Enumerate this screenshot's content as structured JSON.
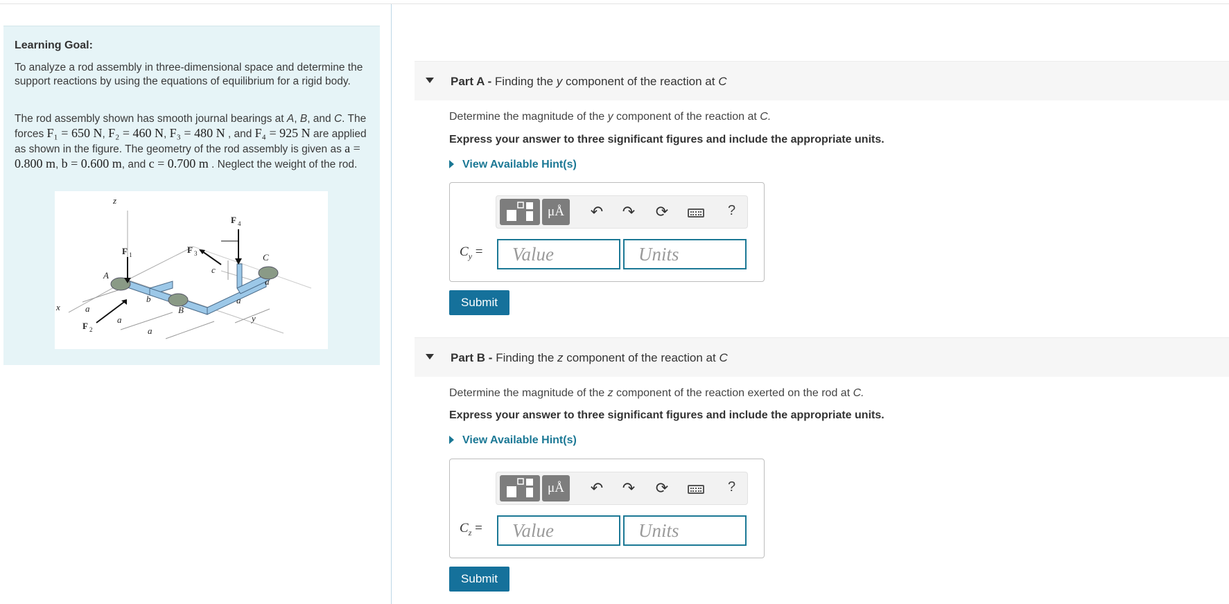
{
  "goal": {
    "label": "Learning Goal:",
    "intro": "To analyze a rod assembly in three-dimensional space and determine the support reactions by using the equations of equilibrium for a rigid body.",
    "p2_a": "The rod assembly shown has smooth journal bearings at ",
    "p2_A": "A",
    "p2_comma1": ", ",
    "p2_B": "B",
    "p2_and": ", and ",
    "p2_C": "C",
    "p2_forces": ". The forces ",
    "F1": "F₁ = 650 N",
    "F2": "F₂ = 460 N",
    "F3": "F₃ = 480 N",
    "F3_tail": " , and",
    "F4": "F₄ = 925 N",
    "applied": " are applied as shown in the figure. The geometry of the rod assembly is given as ",
    "a_val": "a = 0.800 m",
    "b_val": "b = 0.600 m",
    "and": ", and",
    "c_val": "c = 0.700 m",
    "neglect": " . Neglect the weight of the rod."
  },
  "figure": {
    "labels": {
      "z": "z",
      "x": "x",
      "y": "y",
      "F1": "F",
      "F1s": "1",
      "F2": "F",
      "F2s": "2",
      "F3": "F",
      "F3s": "3",
      "F4": "F",
      "F4s": "4",
      "A": "A",
      "B": "B",
      "C": "C",
      "a": "a",
      "b": "b",
      "c": "c"
    }
  },
  "partA": {
    "part": "Part A -",
    "title_pre": " Finding the ",
    "title_var": "y",
    "title_post": " component of the reaction at ",
    "title_pt": "C",
    "question_pre": "Determine the magnitude of the ",
    "question_var": "y",
    "question_post": " component of the reaction at ",
    "question_pt": "C.",
    "instruction": "Express your answer to three significant figures and include the appropriate units.",
    "hint": "View Available Hint(s)",
    "var": "C",
    "var_sub": "y",
    "equals": " =",
    "value_placeholder": "Value",
    "units_placeholder": "Units",
    "submit": "Submit"
  },
  "partB": {
    "part": "Part B -",
    "title_pre": " Finding the ",
    "title_var": "z",
    "title_post": " component of the reaction at ",
    "title_pt": "C",
    "question_pre": "Determine the magnitude of the ",
    "question_var": "z",
    "question_post": " component of the reaction exerted on the rod at ",
    "question_pt": "C.",
    "instruction": "Express your answer to three significant figures and include the appropriate units.",
    "hint": "View Available Hint(s)",
    "var": "C",
    "var_sub": "z",
    "equals": " =",
    "value_placeholder": "Value",
    "units_placeholder": "Units",
    "submit": "Submit"
  },
  "toolbar": {
    "mu": "μÅ",
    "undo_icon": "undo-icon",
    "redo_icon": "redo-icon",
    "reset_icon": "reset-icon",
    "keyboard_icon": "keyboard-icon",
    "help": "?"
  },
  "colors": {
    "accent": "#1b7895",
    "submit": "#15719b",
    "goal_bg": "#e6f4f7",
    "rod": "#9cc8e8"
  }
}
